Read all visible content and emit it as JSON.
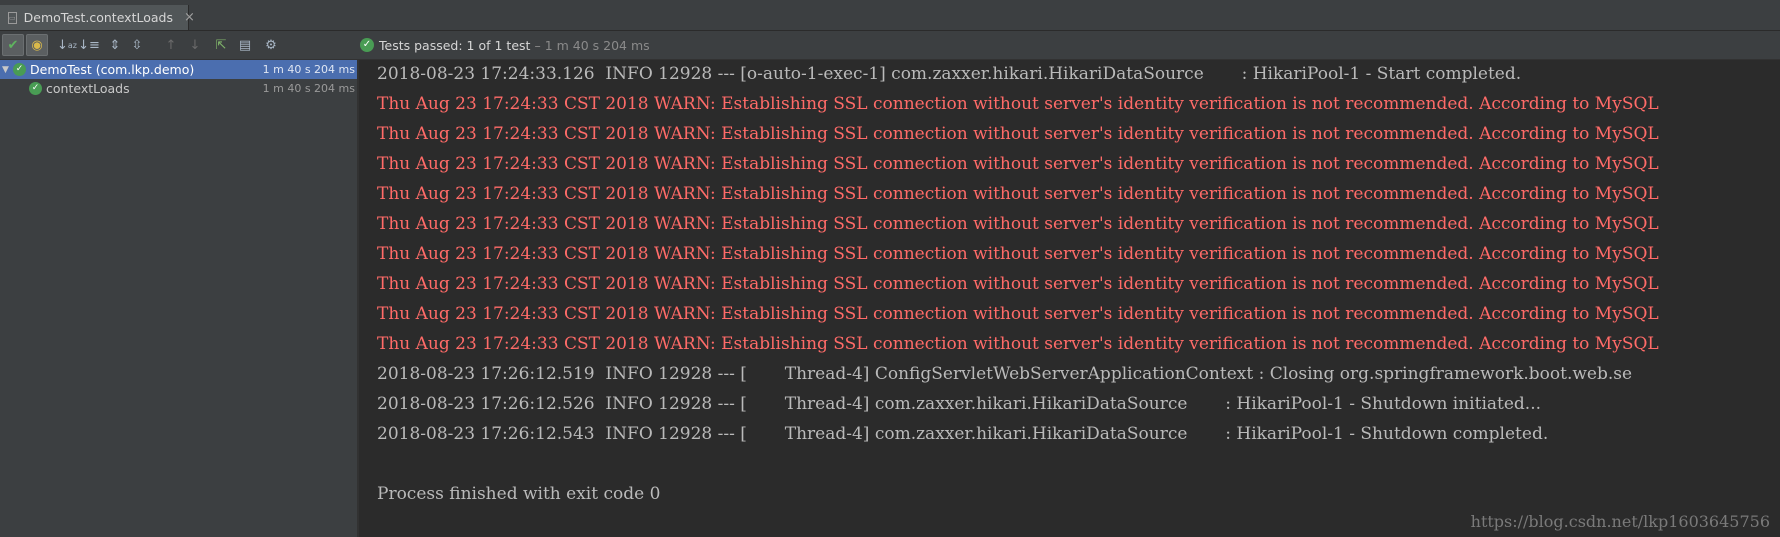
{
  "tab": {
    "title": "DemoTest.contextLoads",
    "close": "×"
  },
  "toolbar": {
    "icons": [
      "passed-filter-icon",
      "ignored-filter-icon",
      "sort-alpha-icon",
      "sort-duration-icon",
      "expand-all-icon",
      "collapse-all-icon",
      "previous-failed-icon",
      "next-failed-icon",
      "export-icon",
      "import-icon",
      "settings-icon"
    ]
  },
  "status": {
    "prefix": "Tests passed:",
    "count": "1",
    "of_text": "of 1 test",
    "sep": "–",
    "duration": "1 m 40 s 204 ms"
  },
  "tree": [
    {
      "label": "DemoTest (com.lkp.demo)",
      "time": "1 m 40 s 204 ms",
      "selected": true
    },
    {
      "label": "contextLoads",
      "time": "1 m 40 s 204 ms",
      "selected": false
    }
  ],
  "console": {
    "lines": [
      {
        "level": "info",
        "text": "2018-08-23 17:24:33.126  INFO 12928 --- [o-auto-1-exec-1] com.zaxxer.hikari.HikariDataSource       : HikariPool-1 - Start completed."
      },
      {
        "level": "warn",
        "text": "Thu Aug 23 17:24:33 CST 2018 WARN: Establishing SSL connection without server's identity verification is not recommended. According to MySQL"
      },
      {
        "level": "warn",
        "text": "Thu Aug 23 17:24:33 CST 2018 WARN: Establishing SSL connection without server's identity verification is not recommended. According to MySQL"
      },
      {
        "level": "warn",
        "text": "Thu Aug 23 17:24:33 CST 2018 WARN: Establishing SSL connection without server's identity verification is not recommended. According to MySQL"
      },
      {
        "level": "warn",
        "text": "Thu Aug 23 17:24:33 CST 2018 WARN: Establishing SSL connection without server's identity verification is not recommended. According to MySQL"
      },
      {
        "level": "warn",
        "text": "Thu Aug 23 17:24:33 CST 2018 WARN: Establishing SSL connection without server's identity verification is not recommended. According to MySQL"
      },
      {
        "level": "warn",
        "text": "Thu Aug 23 17:24:33 CST 2018 WARN: Establishing SSL connection without server's identity verification is not recommended. According to MySQL"
      },
      {
        "level": "warn",
        "text": "Thu Aug 23 17:24:33 CST 2018 WARN: Establishing SSL connection without server's identity verification is not recommended. According to MySQL"
      },
      {
        "level": "warn",
        "text": "Thu Aug 23 17:24:33 CST 2018 WARN: Establishing SSL connection without server's identity verification is not recommended. According to MySQL"
      },
      {
        "level": "warn",
        "text": "Thu Aug 23 17:24:33 CST 2018 WARN: Establishing SSL connection without server's identity verification is not recommended. According to MySQL"
      },
      {
        "level": "info",
        "text": "2018-08-23 17:26:12.519  INFO 12928 --- [       Thread-4] ConfigServletWebServerApplicationContext : Closing org.springframework.boot.web.se"
      },
      {
        "level": "info",
        "text": "2018-08-23 17:26:12.526  INFO 12928 --- [       Thread-4] com.zaxxer.hikari.HikariDataSource       : HikariPool-1 - Shutdown initiated..."
      },
      {
        "level": "info",
        "text": "2018-08-23 17:26:12.543  INFO 12928 --- [       Thread-4] com.zaxxer.hikari.HikariDataSource       : HikariPool-1 - Shutdown completed."
      },
      {
        "level": "info",
        "text": ""
      },
      {
        "level": "info",
        "text": "Process finished with exit code 0"
      }
    ]
  },
  "watermark": "https://blog.csdn.net/lkp1603645756",
  "colors": {
    "info": "#bababa",
    "warn": "#ff6b68",
    "selection": "#4b6eaf",
    "passed": "#499c54"
  }
}
